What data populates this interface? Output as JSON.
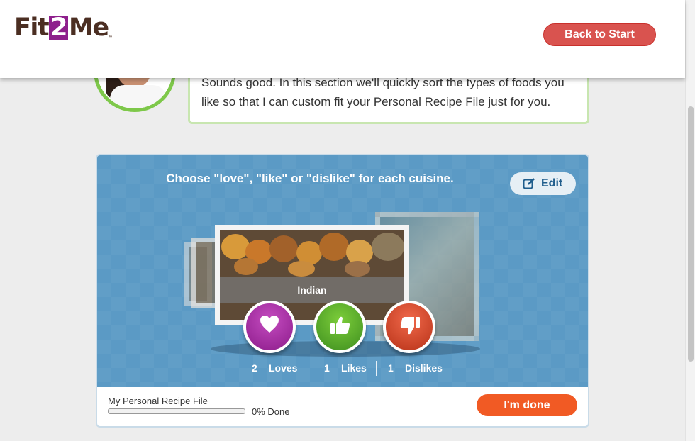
{
  "header": {
    "logo_left": "Fit",
    "logo_num": "2",
    "logo_right": "Me",
    "logo_tm": "™",
    "back_label": "Back to Start"
  },
  "speech": {
    "text": "Sounds good. In this section we'll quickly sort the types of foods you like so that I can custom fit your Personal Recipe File just for you."
  },
  "cuisine": {
    "instruction": "Choose \"love\", \"like\" or \"dislike\" for each cuisine.",
    "edit_label": "Edit",
    "current": "Indian",
    "counts": {
      "loves_num": "2",
      "loves_label": "Loves",
      "likes_num": "1",
      "likes_label": "Likes",
      "dislikes_num": "1",
      "dislikes_label": "Dislikes"
    }
  },
  "progress": {
    "label": "My Personal Recipe File",
    "percent": 0,
    "text": "0% Done",
    "done_label": "I'm done"
  },
  "colors": {
    "back_button": "#d9534f",
    "panel": "#5b9ac5",
    "love": "#8c1b8a",
    "like": "#3e8e1f",
    "dislike": "#b73218",
    "done_button": "#f15a24"
  }
}
